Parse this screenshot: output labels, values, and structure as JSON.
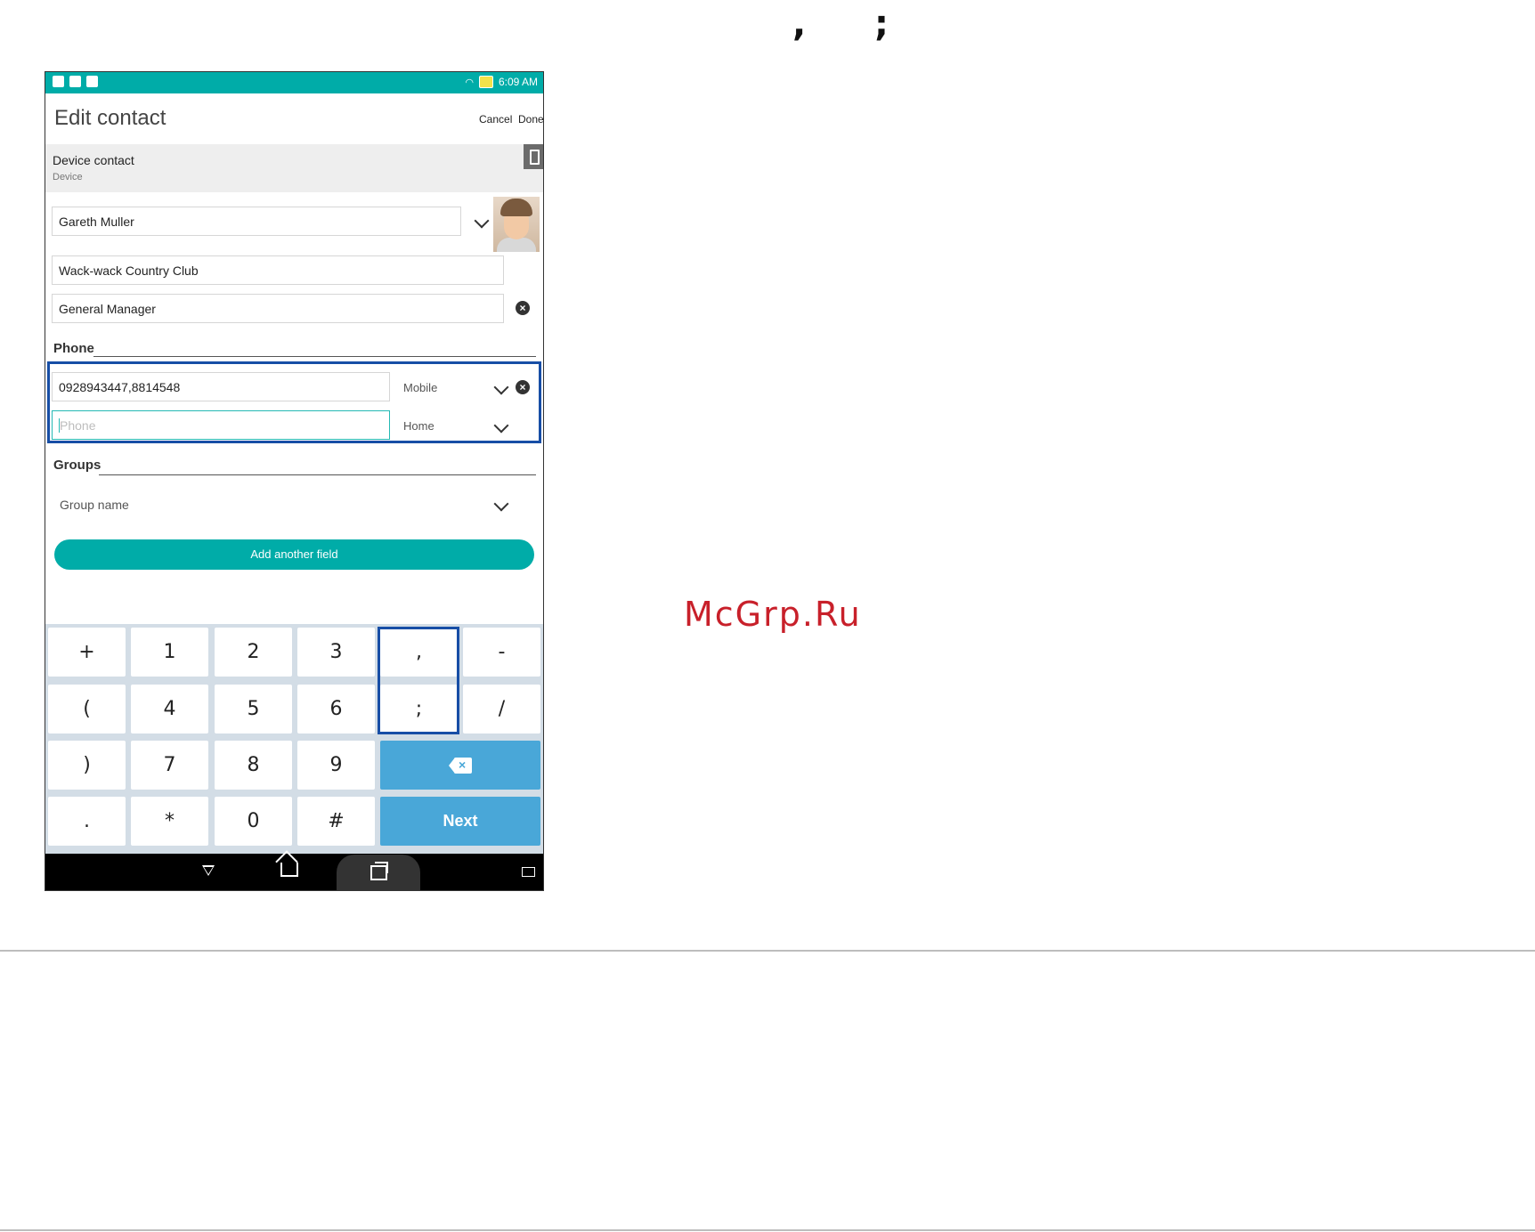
{
  "top_marks": {
    "comma": ",",
    "semicolon": ";"
  },
  "watermark": "McGrp.Ru",
  "status_bar": {
    "time": "6:09 AM"
  },
  "header": {
    "title": "Edit contact",
    "cancel_label": "Cancel",
    "done_label": "Done"
  },
  "account": {
    "name": "Device contact",
    "type": "Device"
  },
  "contact": {
    "name": "Gareth Muller",
    "company": "Wack-wack Country Club",
    "title": "General Manager"
  },
  "phone_section": {
    "label": "Phone",
    "entries": [
      {
        "value": "0928943447,8814548",
        "type": "Mobile"
      },
      {
        "placeholder": "Phone",
        "type": "Home"
      }
    ]
  },
  "groups_section": {
    "label": "Groups",
    "placeholder": "Group name"
  },
  "add_field_label": "Add another field",
  "keypad": {
    "rows": [
      [
        "+",
        "1",
        "2",
        "3",
        ",",
        "-"
      ],
      [
        "(",
        "4",
        "5",
        "6",
        ";",
        "/"
      ],
      [
        ")",
        "7",
        "8",
        "9"
      ],
      [
        ".",
        "*",
        "0",
        "#"
      ]
    ],
    "next_label": "Next"
  },
  "icons": {
    "clear": "clear-icon",
    "backspace": "backspace-icon",
    "back": "back-icon",
    "home": "home-icon",
    "recent": "recent-apps-icon"
  },
  "colors": {
    "accent": "#00aca8",
    "highlight": "#174ea6",
    "key_blue": "#49a7d8"
  }
}
